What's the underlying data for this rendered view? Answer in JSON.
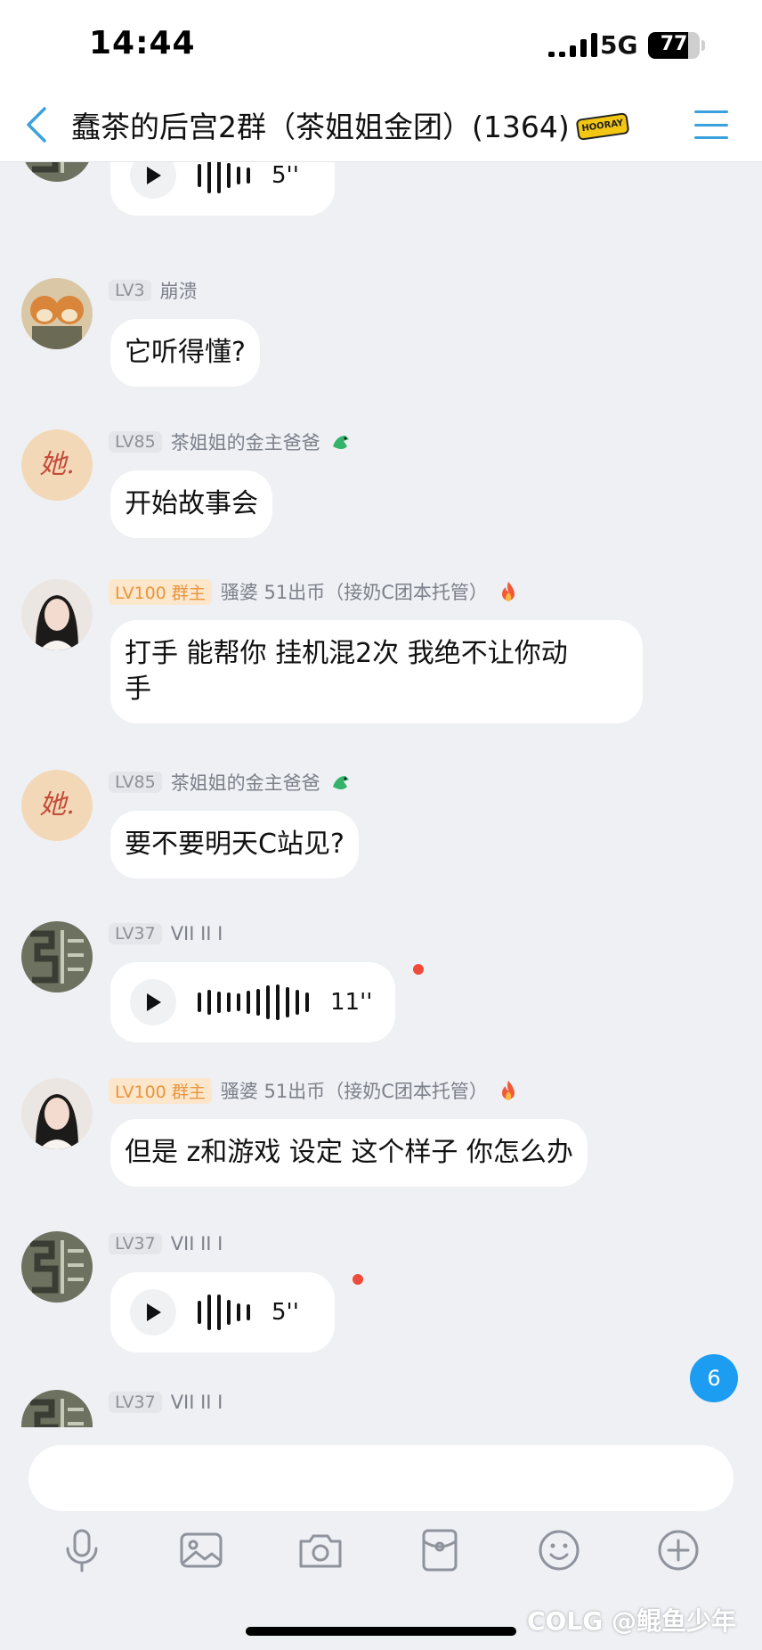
{
  "status_bar": {
    "time": "14:44",
    "network": "5G",
    "battery": "77",
    "battery_level": 0.77
  },
  "header": {
    "title": "蠢茶的后宫2群（茶姐姐金团）(1364)",
    "badge_text": "HOORAY"
  },
  "messages": [
    {
      "kind": "voice",
      "duration": "5''"
    },
    {
      "kind": "text",
      "level": "LV3",
      "name": "崩溃",
      "text": "它听得懂?"
    },
    {
      "kind": "text",
      "level": "LV85",
      "name": "茶姐姐的金主爸爸",
      "text": "开始故事会"
    },
    {
      "kind": "text",
      "level": "LV100",
      "role": "群主",
      "name": "骚婆 51出币（接奶C团本托管）",
      "text_line1": "打手  能帮你 挂机混2次 我绝不让你动",
      "text_line2": "手"
    },
    {
      "kind": "text",
      "level": "LV85",
      "name": "茶姐姐的金主爸爸",
      "text": "要不要明天C站见?"
    },
    {
      "kind": "voice",
      "level": "LV37",
      "name": "VII II I",
      "duration": "11''"
    },
    {
      "kind": "text",
      "level": "LV100",
      "role": "群主",
      "name": "骚婆 51出币（接奶C团本托管）",
      "text": "但是 z和游戏 设定 这个样子 你怎么办"
    },
    {
      "kind": "voice",
      "level": "LV37",
      "name": "VII II I",
      "duration": "5''"
    },
    {
      "kind": "partial",
      "level": "LV37",
      "name": "VII II I"
    }
  ],
  "unread_count": "6",
  "avatar_text": "她.",
  "watermark": "@鲲鱼少年",
  "watermark_brand": "COLG",
  "colors": {
    "accent": "#3aa1de",
    "badge": "#1c9df1",
    "unread_dot": "#f04a3a",
    "owner_tag": "#e8953a"
  },
  "toolbar_icons": [
    "mic-icon",
    "image-icon",
    "camera-icon",
    "red-packet-icon",
    "emoji-icon",
    "plus-icon"
  ]
}
